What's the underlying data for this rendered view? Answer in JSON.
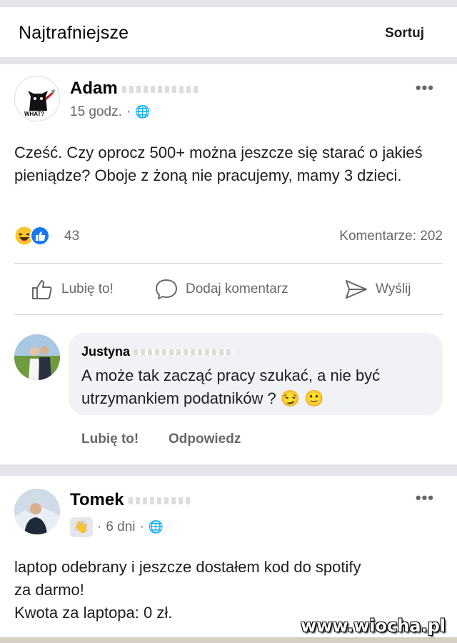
{
  "header": {
    "title": "Najtrafniejsze",
    "sort_label": "Sortuj"
  },
  "post1": {
    "author": "Adam",
    "time": "15 godz.",
    "separator": "·",
    "text": "Cześć. Czy oprocz 500+ można jeszcze się starać o jakieś pieniądze? Oboje z żoną nie pracujemy, mamy 3 dzieci.",
    "reaction_count": "43",
    "comments_label": "Komentarze: 202",
    "avatar_caption": "WHAT?",
    "actions": {
      "like": "Lubię to!",
      "comment": "Dodaj komentarz",
      "send": "Wyślij"
    }
  },
  "comment1": {
    "author": "Justyna",
    "text": "A może tak zacząć pracy szukać, a nie być utrzymankiem podatników ?",
    "emojis": "😏 🙂",
    "like": "Lubię to!",
    "reply": "Odpowiedz"
  },
  "post2": {
    "author": "Tomek",
    "time": "6 dni",
    "separator": "·",
    "text_line1": "laptop odebrany i jeszcze dostałem kod do spotify",
    "text_line2": "za darmo!",
    "text_line3": "Kwota za laptopa: 0 zł."
  },
  "watermark": "www.wiocha.pl",
  "colors": {
    "link_blue": "#1877f2",
    "secondary_text": "#65676b",
    "bubble_bg": "#f0f2f5"
  }
}
